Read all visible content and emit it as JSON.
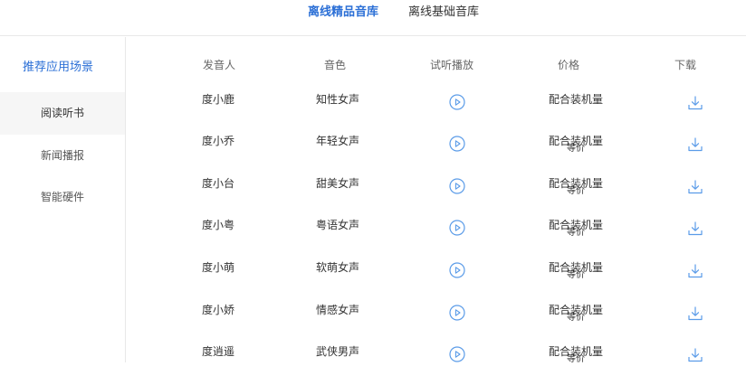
{
  "tabs": [
    {
      "label": "离线精品音库",
      "active": true
    },
    {
      "label": "离线基础音库",
      "active": false
    }
  ],
  "sidebar": {
    "title": "推荐应用场景",
    "items": [
      {
        "label": "阅读听书",
        "selected": true
      },
      {
        "label": "新闻播报",
        "selected": false
      },
      {
        "label": "智能硬件",
        "selected": false
      }
    ]
  },
  "table": {
    "headers": {
      "speaker": "发音人",
      "timbre": "音色",
      "preview": "试听播放",
      "price": "价格",
      "download": "下载"
    },
    "rows": [
      {
        "speaker": "度小鹿",
        "timbre": "知性女声",
        "price": "配合装机量",
        "price_sub": ""
      },
      {
        "speaker": "度小乔",
        "timbre": "年轻女声",
        "price": "配合装机量",
        "price_sub": "等价"
      },
      {
        "speaker": "度小台",
        "timbre": "甜美女声",
        "price": "配合装机量",
        "price_sub": "等价"
      },
      {
        "speaker": "度小粤",
        "timbre": "粤语女声",
        "price": "配合装机量",
        "price_sub": "等价"
      },
      {
        "speaker": "度小萌",
        "timbre": "软萌女声",
        "price": "配合装机量",
        "price_sub": "等价"
      },
      {
        "speaker": "度小娇",
        "timbre": "情感女声",
        "price": "配合装机量",
        "price_sub": "等价"
      },
      {
        "speaker": "度逍遥",
        "timbre": "武侠男声",
        "price": "配合装机量",
        "price_sub": "等价"
      }
    ]
  },
  "icons": {
    "play": "play-circle-icon",
    "download": "download-tray-icon"
  },
  "colors": {
    "accent": "#2b6fd6",
    "icon": "#5a9be8",
    "divider": "#e8e8e8"
  }
}
